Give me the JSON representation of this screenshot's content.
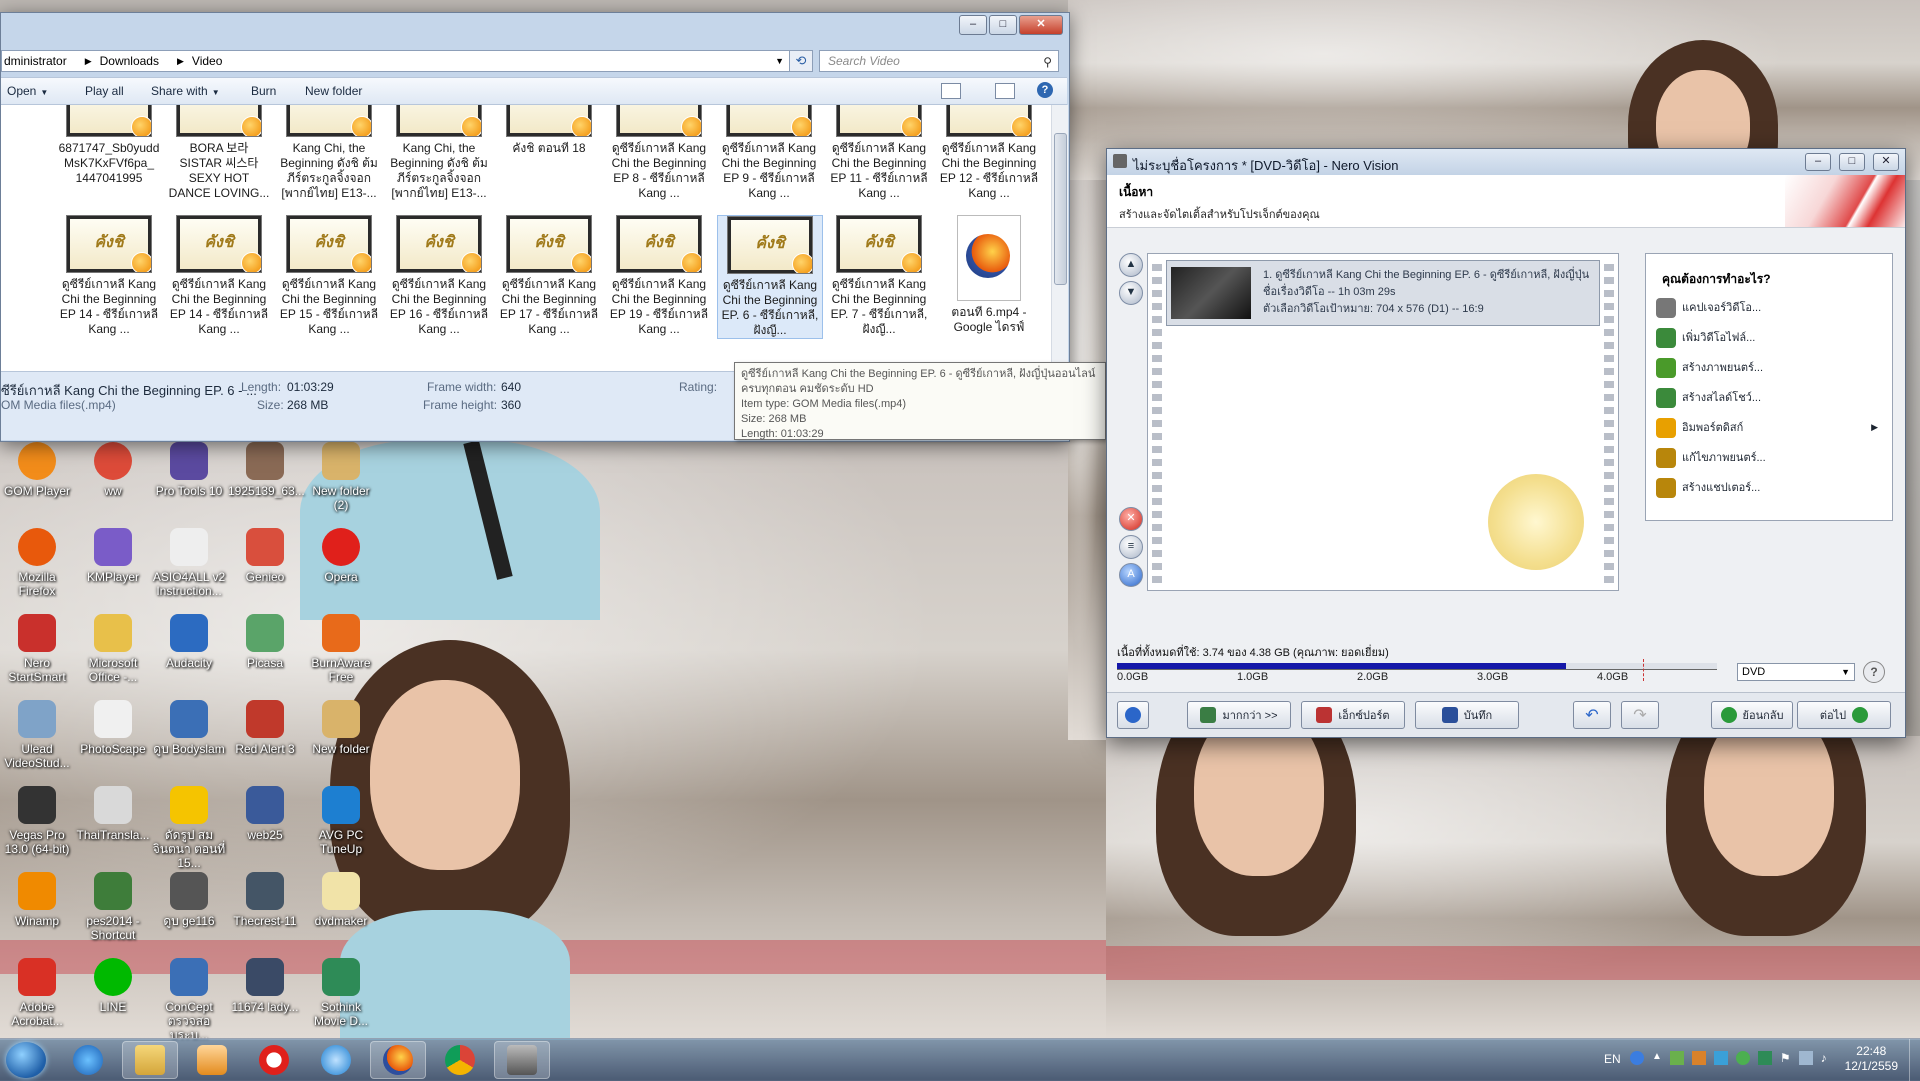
{
  "explorer": {
    "breadcrumb": [
      "dministrator",
      "Downloads",
      "Video"
    ],
    "search_placeholder": "Search Video",
    "toolbar": {
      "open": "Open",
      "play_all": "Play all",
      "share_with": "Share with",
      "burn": "Burn",
      "new_folder": "New folder"
    },
    "files_row1": [
      "6871747_Sb0yudd MsK7KxFVf6pa_ 1447041995",
      "BORA 보라 SISTAR 씨스타 SEXY HOT DANCE LOVING...",
      "Kang Chi, the Beginning ดังชิ ต้มภีร์ตระกูลจิ้งจอก [พากย์ไทย] E13-...",
      "Kang Chi, the Beginning ดังชิ ต้มภีร์ตระกูลจิ้งจอก [พากย์ไทย] E13-...",
      "คังชิ ตอนที่ 18",
      "ดูซีรีย์เกาหลี Kang Chi the Beginning EP 8 - ซีรีย์เกาหลี Kang ...",
      "ดูซีรีย์เกาหลี Kang Chi the Beginning EP 9 - ซีรีย์เกาหลี Kang ...",
      "ดูซีรีย์เกาหลี Kang Chi the Beginning EP 11 - ซีรีย์เกาหลี Kang ...",
      "ดูซีรีย์เกาหลี Kang Chi the Beginning EP 12 - ซีรีย์เกาหลี Kang ..."
    ],
    "files_row2": [
      "ดูซีรีย์เกาหลี Kang Chi the Beginning EP 14 - ซีรีย์เกาหลี Kang ...",
      "ดูซีรีย์เกาหลี Kang Chi the Beginning EP 14 - ซีรีย์เกาหลี Kang ...",
      "ดูซีรีย์เกาหลี Kang Chi the Beginning EP 15 - ซีรีย์เกาหลี Kang ...",
      "ดูซีรีย์เกาหลี Kang Chi the Beginning EP 16 - ซีรีย์เกาหลี Kang ...",
      "ดูซีรีย์เกาหลี Kang Chi the Beginning EP 17 - ซีรีย์เกาหลี Kang ...",
      "ดูซีรีย์เกาหลี Kang Chi the Beginning EP 19 - ซีรีย์เกาหลี Kang ...",
      "ดูซีรีย์เกาหลี Kang Chi the Beginning EP. 6 - ซีรีย์เกาหลี, ฝังญี...",
      "ดูซีรีย์เกาหลี Kang Chi the Beginning EP. 7 - ซีรีย์เกาหลี, ฝังญี...",
      "ตอนที่ 6.mp4 - Google ไดรฟ์"
    ],
    "thumb_logo": "คังชิ",
    "details": {
      "name": "ซีรีย์เกาหลี Kang Chi the Beginning EP. 6 - ...",
      "type": "OM Media files(.mp4)",
      "length_label": "Length:",
      "length": "01:03:29",
      "size_label": "Size:",
      "size": "268 MB",
      "fw_label": "Frame width:",
      "fw": "640",
      "fh_label": "Frame height:",
      "fh": "360",
      "rating_label": "Rating:"
    },
    "tooltip": [
      "ดูซีรีย์เกาหลี Kang Chi the Beginning EP. 6 - ดูซีรีย์เกาหลี, ฝังญี่ปุ่นออนไลน์",
      "ครบทุกตอน คมชัดระดับ HD",
      "Item type: GOM Media files(.mp4)",
      "Size: 268 MB",
      "Length: 01:03:29"
    ]
  },
  "desktop_icons": [
    "GOM Player",
    "ww",
    "Pro Tools 10",
    "1925139_63...",
    "New folder (2)",
    "Mozilla Firefox",
    "KMPlayer",
    "ASIO4ALL v2 Instruction...",
    "Genieo",
    "Opera",
    "Nero StartSmart",
    "Microsoft Office -...",
    "Audacity",
    "Picasa",
    "BurnAware Free",
    "Ulead VideoStud...",
    "PhotoScape",
    "ดูบ Bodyslam",
    "Red Alert 3",
    "New folder",
    "Vegas Pro 13.0 (64-bit)",
    "ThaiTransla...",
    "ดัดรูป สมจินตนา ตอนที่ 15...",
    "web25",
    "AVG PC TuneUp",
    "Winamp",
    "pes2014 - Shortcut",
    "ดูบ ge116",
    "Thecrest-11",
    "dvdmaker",
    "Adobe Acrobat...",
    "LINE",
    "ConCept ตรวจสอบระบ...",
    "11674 lady...",
    "Sothink Movie D..."
  ],
  "nero": {
    "title": "ไม่ระบุชื่อโครงการ * [DVD-วิดีโอ] - Nero Vision",
    "header_title": "เนื้อหา",
    "header_sub": "สร้างและจัดไตเติ้ลสำหรับโปรเจ็กต์ของคุณ",
    "item_lines": [
      "1. ดูซีรีย์เกาหลี Kang Chi the Beginning EP. 6 - ดูซีรีย์เกาหลี, ฝังญี่ปุ่น",
      "ชื่อเรื่องวิดีโอ -- 1h 03m 29s",
      "ตัวเลือกวิดีโอเป้าหมาย: 704 x 576 (D1) -- 16:9"
    ],
    "menu_title": "คุณต้องการทำอะไร?",
    "menu_items": [
      "แคปเจอร์วิดีโอ...",
      "เพิ่มวิดีโอไฟล์...",
      "สร้างภาพยนตร์...",
      "สร้างสไลด์โชว์...",
      "อิมพอร์ตดิสก์",
      "แก้ไขภาพยนตร์...",
      "สร้างแชปเตอร์..."
    ],
    "capacity_text": "เนื้อที่ทั้งหมดที่ใช้: 3.74 ของ 4.38 GB (คุณภาพ: ยอดเยี่ยม)",
    "capacity_used_gb": 3.74,
    "capacity_total_gb": 4.38,
    "capacity_ticks": [
      "0.0GB",
      "1.0GB",
      "2.0GB",
      "3.0GB",
      "4.0GB"
    ],
    "disc_type": "DVD",
    "buttons": {
      "more": "มากกว่า >>",
      "export": "เอ็กซ์ปอร์ต",
      "save": "บันทึก",
      "back": "ย้อนกลับ",
      "next": "ต่อไป"
    }
  },
  "taskbar": {
    "lang": "EN",
    "time": "22:48",
    "date": "12/1/2559"
  }
}
